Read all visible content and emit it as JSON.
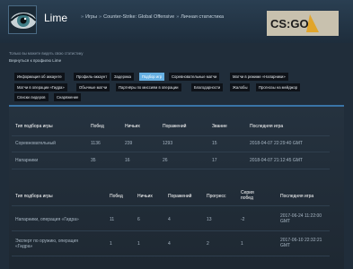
{
  "profile": {
    "name": "Lime"
  },
  "breadcrumb": [
    "Игры",
    "Counter-Strike: Global Offensive",
    "Личная статистика"
  ],
  "privacy_note": "Только вы можете видеть свою статистику",
  "back_link": "Вернуться к профилю Lime",
  "tabs": [
    "Информация об аккаунте",
    "Профиль-аккаунт",
    "Задержка",
    "Подбор игр",
    "Соревновательные матчи",
    "Матчи в режиме «Напарники»",
    "Матчи в операции «Гидра»",
    "Обычные матчи",
    "Партнёры по миссиям в операции",
    "Благодарности",
    "Жалобы",
    "Прогнозы на мейджор",
    "Списки лидеров",
    "Снаряжение"
  ],
  "active_tab": "Подбор игр",
  "table1": {
    "headers": [
      "Тип подбора игры",
      "Побед",
      "Ничьих",
      "Поражений",
      "Звание",
      "Последняя игра"
    ],
    "rows": [
      [
        "Соревновательный",
        "1136",
        "239",
        "1293",
        "15",
        "2018-04-07 22:29:40 GMT"
      ],
      [
        "Напарники",
        "35",
        "16",
        "26",
        "17",
        "2018-04-07 21:12:45 GMT"
      ]
    ]
  },
  "table2": {
    "headers": [
      "Тип подбора игры",
      "Побед",
      "Ничьих",
      "Поражений",
      "Прогресс",
      "Серия побед",
      "Последняя игра"
    ],
    "rows": [
      [
        "Напарники, операция «Гидра»",
        "11",
        "6",
        "4",
        "13",
        "-2",
        "2017-06-24 11:22:00 GMT"
      ],
      [
        "Эксперт по оружию, операция «Гидра»",
        "1",
        "1",
        "4",
        "2",
        "1",
        "2017-06-10 22:32:21 GMT"
      ]
    ]
  },
  "colors": {
    "accent": "#66b0e3",
    "background": "#1b2838",
    "bar": "#3a74a6"
  },
  "logo_text": "CS:GO"
}
